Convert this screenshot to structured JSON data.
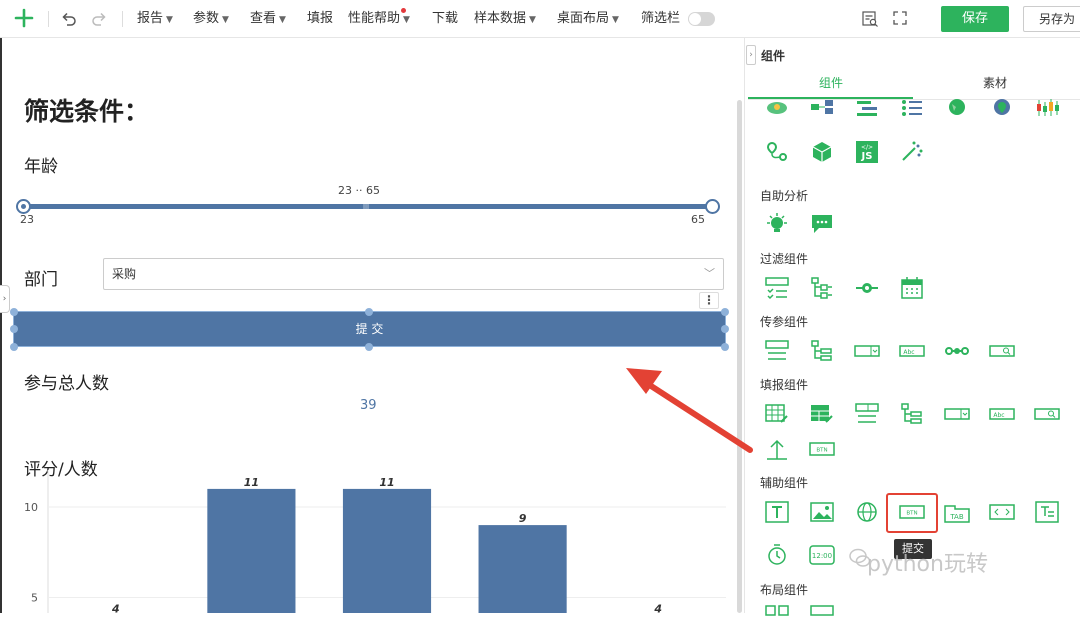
{
  "toolbar": {
    "report_label": "报告",
    "param_label": "参数",
    "view_label": "查看",
    "fill_label": "填报",
    "perf_label": "性能帮助",
    "download_label": "下载",
    "sample_label": "样本数据",
    "desktop_label": "桌面布局",
    "filterbar_label": "筛选栏",
    "save_label": "保存",
    "saveas_label": "另存为"
  },
  "canvas": {
    "heading": "筛选条件：",
    "age_label": "年龄",
    "range_text": "23 ·· 65",
    "range_min": "23",
    "range_max": "65",
    "dept_label": "部门",
    "dept_value": "采购",
    "submit_label": "提 交",
    "count_title": "参与总人数",
    "count_value": "39",
    "chart_title": "评分/人数"
  },
  "chart_data": {
    "type": "bar",
    "values": [
      4,
      11,
      11,
      9,
      4
    ],
    "yticks": [
      "10",
      "5"
    ]
  },
  "panel": {
    "title": "组件",
    "tab_components": "组件",
    "tab_assets": "素材",
    "sec_self": "自助分析",
    "sec_filter": "过滤组件",
    "sec_param": "传参组件",
    "sec_fill": "填报组件",
    "sec_aux": "辅助组件",
    "sec_layout": "布局组件",
    "tooltip": "提交",
    "watermark": "python玩转"
  },
  "colors": {
    "accent": "#2db35d",
    "bar": "#4f75a4",
    "highlight": "#e34234"
  }
}
